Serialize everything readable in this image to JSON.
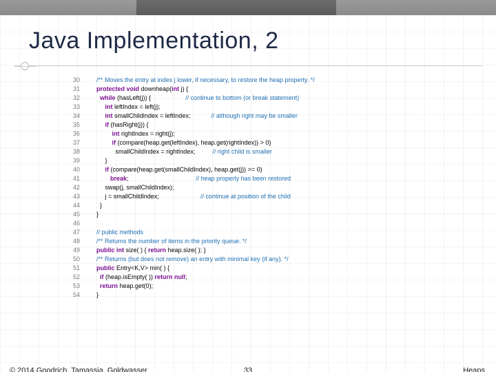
{
  "title": "Java Implementation, 2",
  "footer": {
    "left": "© 2014 Goodrich, Tamassia, Goldwasser",
    "center": "33",
    "right": "Heaps"
  },
  "code": [
    {
      "n": 30,
      "segs": [
        [
          "    ",
          ""
        ],
        [
          "/** Moves the entry at index j lower, if necessary, to restore the heap property. */",
          "cm"
        ]
      ]
    },
    {
      "n": 31,
      "segs": [
        [
          "    ",
          ""
        ],
        [
          "protected void",
          "kw"
        ],
        [
          " downheap(",
          ""
        ],
        [
          "int",
          "kw"
        ],
        [
          " j) {",
          ""
        ]
      ]
    },
    {
      "n": 32,
      "segs": [
        [
          "      ",
          ""
        ],
        [
          "while",
          "kw"
        ],
        [
          " (hasLeft(j)) {                    ",
          ""
        ],
        [
          "// continue to bottom (or break statement)",
          "cm"
        ]
      ]
    },
    {
      "n": 33,
      "segs": [
        [
          "         ",
          ""
        ],
        [
          "int",
          "kw"
        ],
        [
          " leftIndex = left(j);",
          ""
        ]
      ]
    },
    {
      "n": 34,
      "segs": [
        [
          "         ",
          ""
        ],
        [
          "int",
          "kw"
        ],
        [
          " smallChildIndex = leftIndex;            ",
          ""
        ],
        [
          "// although right may be smaller",
          "cm"
        ]
      ]
    },
    {
      "n": 35,
      "segs": [
        [
          "         ",
          ""
        ],
        [
          "if",
          "kw"
        ],
        [
          " (hasRight(j)) {",
          ""
        ]
      ]
    },
    {
      "n": 36,
      "segs": [
        [
          "             ",
          ""
        ],
        [
          "int",
          "kw"
        ],
        [
          " rightIndex = right(j);",
          ""
        ]
      ]
    },
    {
      "n": 37,
      "segs": [
        [
          "             ",
          ""
        ],
        [
          "if",
          "kw"
        ],
        [
          " (compare(heap.get(leftIndex), heap.get(rightIndex)) > 0)",
          ""
        ]
      ]
    },
    {
      "n": 38,
      "segs": [
        [
          "               smallChildIndex = rightIndex;          ",
          ""
        ],
        [
          "// right child is smaller",
          "cm"
        ]
      ]
    },
    {
      "n": 39,
      "segs": [
        [
          "         }",
          ""
        ]
      ]
    },
    {
      "n": 40,
      "segs": [
        [
          "         ",
          ""
        ],
        [
          "if",
          "kw"
        ],
        [
          " (compare(heap.get(smallChildIndex), heap.get(j)) >= 0)",
          ""
        ]
      ]
    },
    {
      "n": 41,
      "segs": [
        [
          "            ",
          ""
        ],
        [
          "break",
          "kw"
        ],
        [
          ";                                       ",
          ""
        ],
        [
          "// heap property has been restored",
          "cm"
        ]
      ]
    },
    {
      "n": 42,
      "segs": [
        [
          "         swap(j, smallChildIndex);",
          ""
        ]
      ]
    },
    {
      "n": 43,
      "segs": [
        [
          "         j = smallChildIndex;                        ",
          ""
        ],
        [
          "// continue at position of the child",
          "cm"
        ]
      ]
    },
    {
      "n": 44,
      "segs": [
        [
          "      }",
          ""
        ]
      ]
    },
    {
      "n": 45,
      "segs": [
        [
          "    }",
          ""
        ]
      ]
    },
    {
      "n": 46,
      "segs": [
        [
          "",
          ""
        ]
      ]
    },
    {
      "n": 47,
      "segs": [
        [
          "    ",
          ""
        ],
        [
          "// public methods",
          "cm"
        ]
      ]
    },
    {
      "n": 48,
      "segs": [
        [
          "    ",
          ""
        ],
        [
          "/** Returns the number of items in the priority queue. */",
          "cm"
        ]
      ]
    },
    {
      "n": 49,
      "segs": [
        [
          "    ",
          ""
        ],
        [
          "public int",
          "kw"
        ],
        [
          " size( ) { ",
          ""
        ],
        [
          "return",
          "kw"
        ],
        [
          " heap.size( ); }",
          ""
        ]
      ]
    },
    {
      "n": 50,
      "segs": [
        [
          "    ",
          ""
        ],
        [
          "/** Returns (but does not remove) an entry with minimal key (if any). */",
          "cm"
        ]
      ]
    },
    {
      "n": 51,
      "segs": [
        [
          "    ",
          ""
        ],
        [
          "public",
          "kw"
        ],
        [
          " Entry<K,V> min( ) {",
          ""
        ]
      ]
    },
    {
      "n": 52,
      "segs": [
        [
          "      ",
          ""
        ],
        [
          "if",
          "kw"
        ],
        [
          " (heap.isEmpty( )) ",
          ""
        ],
        [
          "return null",
          "kw"
        ],
        [
          ";",
          ""
        ]
      ]
    },
    {
      "n": 53,
      "segs": [
        [
          "      ",
          ""
        ],
        [
          "return",
          "kw"
        ],
        [
          " heap.get(0);",
          ""
        ]
      ]
    },
    {
      "n": 54,
      "segs": [
        [
          "    }",
          ""
        ]
      ]
    }
  ]
}
